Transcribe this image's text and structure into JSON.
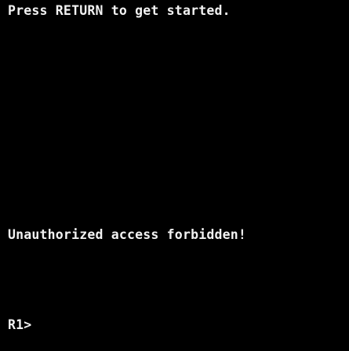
{
  "terminal": {
    "line_1": "Press RETURN to get started.",
    "line_2": "Unauthorized access forbidden!",
    "prompt": "R1>"
  },
  "colors": {
    "background": "#000000",
    "text": "#f2f2f2"
  }
}
